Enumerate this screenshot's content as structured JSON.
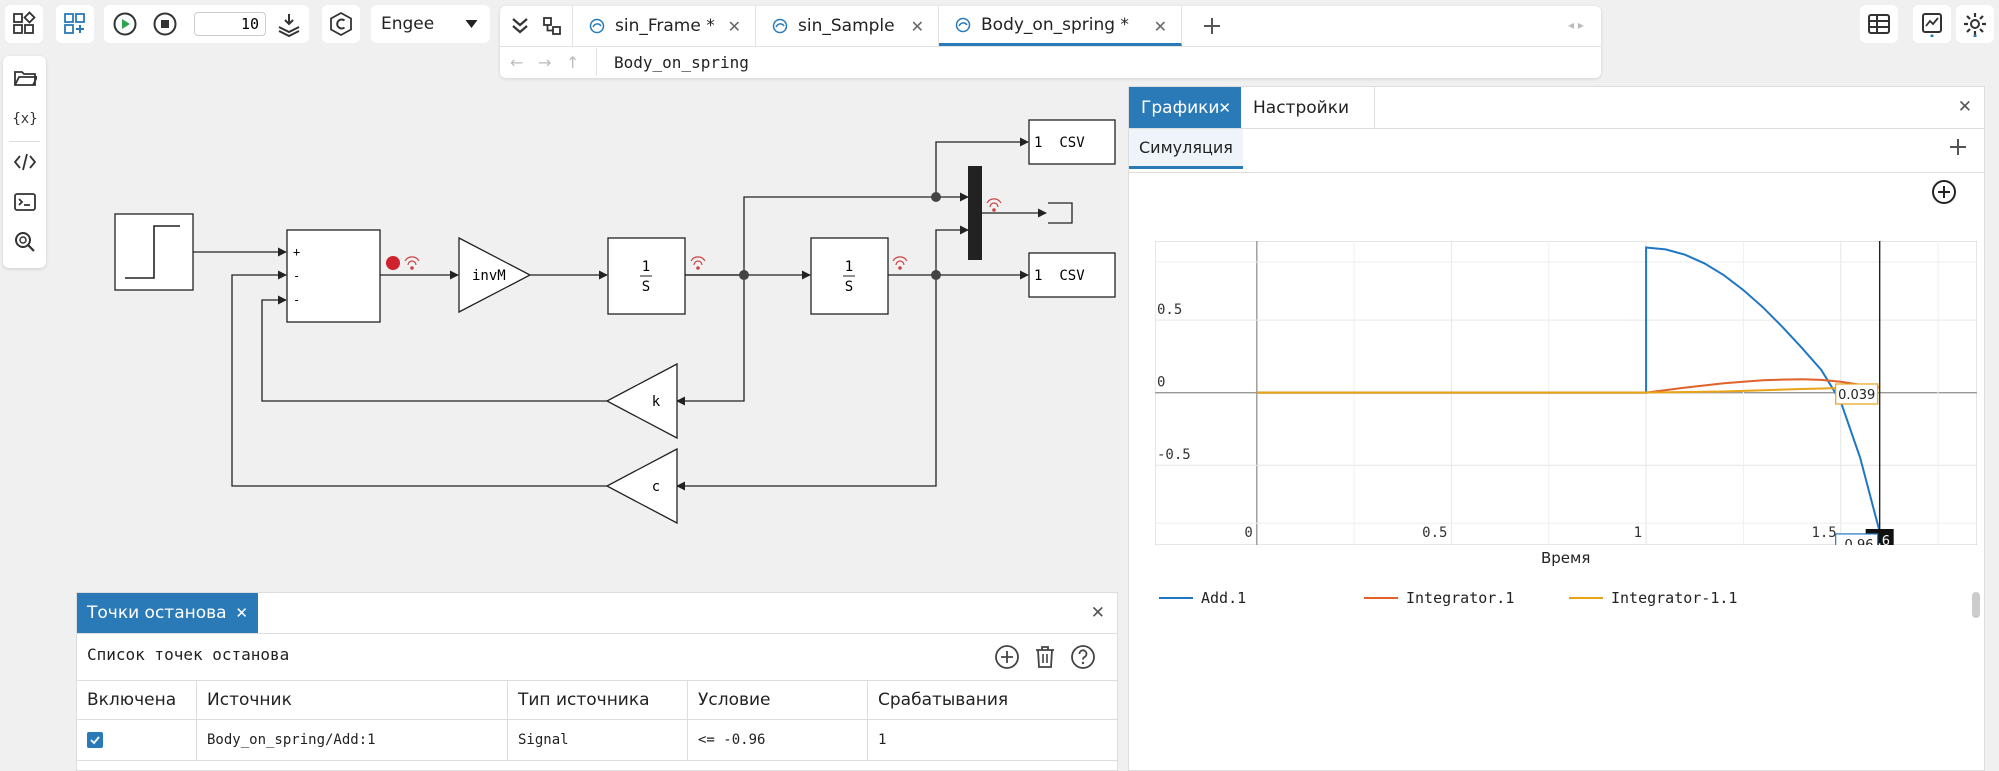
{
  "toolbar": {
    "step_count": "10",
    "solver_selected": "Engee"
  },
  "tabs": [
    {
      "label": "sin_Frame *"
    },
    {
      "label": "sin_Sample"
    },
    {
      "label": "Body_on_spring *"
    }
  ],
  "breadcrumb": "Body_on_spring",
  "diagram": {
    "blocks": {
      "csv_top": "CSV",
      "csv_bottom": "CSV",
      "port_top": "1",
      "port_bottom": "1",
      "gain": "invM",
      "integrator_num": "1",
      "integrator_den": "S",
      "integrator2_num": "1",
      "integrator2_den": "S",
      "gain_k": "k",
      "gain_c": "c",
      "sum_signs": [
        "+",
        "-",
        "-"
      ]
    }
  },
  "graphs_panel": {
    "tab_graphs": "Графики",
    "tab_settings": "Настройки",
    "subtab": "Симуляция"
  },
  "chart_data": {
    "type": "line",
    "title": "",
    "xlabel": "Время",
    "ylabel": "",
    "xlim": [
      -0.02,
      1.85
    ],
    "ylim": [
      -1.05,
      0.99
    ],
    "x_ticks": [
      0,
      0.5,
      1,
      1.5
    ],
    "x_tick_labels": [
      "0",
      "0.5",
      "1",
      "1.5"
    ],
    "y_ticks": [
      0.5,
      0,
      -0.5
    ],
    "y_tick_labels": [
      "0.5",
      "0",
      "-0.5"
    ],
    "grid": true,
    "legend_position": "bottom",
    "cursor": {
      "x": 1.6,
      "label": "1.6"
    },
    "cursor_values": [
      {
        "series": "Add.1",
        "value": "-0.96",
        "color": "#1f77c4"
      },
      {
        "series": "Integrator-1.1",
        "value": "0.039",
        "color": "#e8a317"
      }
    ],
    "series": [
      {
        "name": "Add.1",
        "color": "#1f77c4",
        "points": [
          [
            0,
            0
          ],
          [
            1,
            0
          ],
          [
            1.0,
            1.0
          ],
          [
            1.05,
            0.987
          ],
          [
            1.1,
            0.951
          ],
          [
            1.15,
            0.891
          ],
          [
            1.2,
            0.809
          ],
          [
            1.25,
            0.707
          ],
          [
            1.3,
            0.588
          ],
          [
            1.35,
            0.454
          ],
          [
            1.4,
            0.309
          ],
          [
            1.45,
            0.156
          ],
          [
            1.5,
            -0.062
          ],
          [
            1.55,
            -0.45
          ],
          [
            1.6,
            -0.96
          ]
        ]
      },
      {
        "name": "Integrator.1",
        "color": "#e0622a",
        "points": [
          [
            0,
            0
          ],
          [
            1,
            0
          ],
          [
            1.1,
            0.035
          ],
          [
            1.2,
            0.065
          ],
          [
            1.3,
            0.085
          ],
          [
            1.35,
            0.09
          ],
          [
            1.4,
            0.092
          ],
          [
            1.45,
            0.088
          ],
          [
            1.5,
            0.075
          ],
          [
            1.55,
            0.055
          ],
          [
            1.6,
            0.035
          ]
        ]
      },
      {
        "name": "Integrator-1.1",
        "color": "#e8a317",
        "points": [
          [
            0,
            0
          ],
          [
            1,
            0
          ],
          [
            1.2,
            0.008
          ],
          [
            1.4,
            0.025
          ],
          [
            1.6,
            0.039
          ]
        ]
      }
    ]
  },
  "breakpoints": {
    "tab_label": "Точки останова",
    "list_title": "Список точек останова",
    "columns": [
      "Включена",
      "Источник",
      "Тип источника",
      "Условие",
      "Срабатывания"
    ],
    "rows": [
      {
        "enabled": true,
        "source": "Body_on_spring/Add:1",
        "source_type": "Signal",
        "condition": "<= -0.96",
        "hits": "1"
      }
    ]
  }
}
